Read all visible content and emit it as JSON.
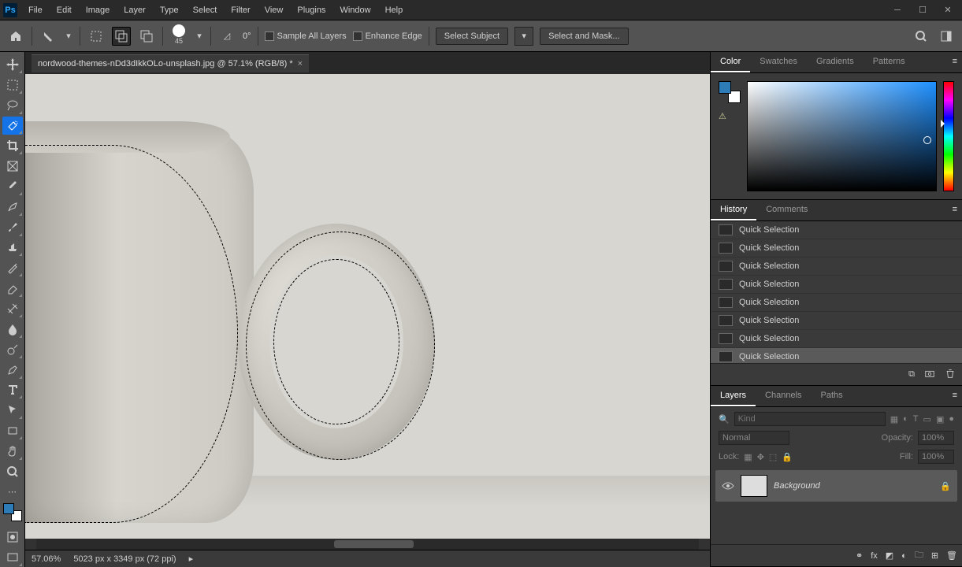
{
  "app": {
    "logo": "Ps"
  },
  "menu": [
    "File",
    "Edit",
    "Image",
    "Layer",
    "Type",
    "Select",
    "Filter",
    "View",
    "Plugins",
    "Window",
    "Help"
  ],
  "options": {
    "brush_size": "45",
    "angle_label": "0°",
    "sample_all": "Sample All Layers",
    "enhance_edge": "Enhance Edge",
    "select_subject": "Select Subject",
    "select_and_mask": "Select and Mask..."
  },
  "document": {
    "tab_title": "nordwood-themes-nDd3dIkkOLo-unsplash.jpg @ 57.1% (RGB/8) *"
  },
  "status": {
    "zoom": "57.06%",
    "dims": "5023 px x 3349 px (72 ppi)"
  },
  "panels": {
    "color_tabs": [
      "Color",
      "Swatches",
      "Gradients",
      "Patterns"
    ],
    "history_tabs": [
      "History",
      "Comments"
    ],
    "history_items": [
      "Quick Selection",
      "Quick Selection",
      "Quick Selection",
      "Quick Selection",
      "Quick Selection",
      "Quick Selection",
      "Quick Selection",
      "Quick Selection"
    ],
    "layers_tabs": [
      "Layers",
      "Channels",
      "Paths"
    ],
    "layers": {
      "kind_placeholder": "Kind",
      "blend_mode": "Normal",
      "opacity_label": "Opacity:",
      "opacity_value": "100%",
      "lock_label": "Lock:",
      "fill_label": "Fill:",
      "fill_value": "100%",
      "background_name": "Background"
    }
  }
}
